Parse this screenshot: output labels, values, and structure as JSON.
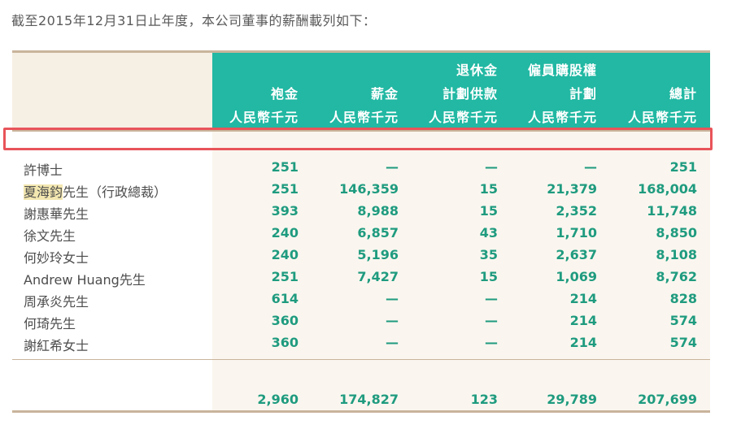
{
  "intro": "截至2015年12月31日止年度，本公司董事的薪酬載列如下：",
  "columns": [
    {
      "l1": "",
      "l2": "袍金",
      "l3": "人民幣千元"
    },
    {
      "l1": "",
      "l2": "薪金",
      "l3": "人民幣千元"
    },
    {
      "l1": "退休金",
      "l2": "計劃供款",
      "l3": "人民幣千元"
    },
    {
      "l1": "僱員購股權",
      "l2": "計劃",
      "l3": "人民幣千元"
    },
    {
      "l1": "",
      "l2": "總計",
      "l3": "人民幣千元"
    }
  ],
  "rows": [
    {
      "name": "許博士",
      "v": [
        "251",
        "—",
        "—",
        "—",
        "251"
      ]
    },
    {
      "name_hl": "夏海鈞",
      "name_rest": "先生（行政總裁）",
      "v": [
        "251",
        "146,359",
        "15",
        "21,379",
        "168,004"
      ]
    },
    {
      "name": "謝惠華先生",
      "v": [
        "393",
        "8,988",
        "15",
        "2,352",
        "11,748"
      ]
    },
    {
      "name": "徐文先生",
      "v": [
        "240",
        "6,857",
        "43",
        "1,710",
        "8,850"
      ]
    },
    {
      "name": "何妙玲女士",
      "v": [
        "240",
        "5,196",
        "35",
        "2,637",
        "8,108"
      ]
    },
    {
      "name": "Andrew Huang先生",
      "v": [
        "251",
        "7,427",
        "15",
        "1,069",
        "8,762"
      ]
    },
    {
      "name": "周承炎先生",
      "v": [
        "614",
        "—",
        "—",
        "214",
        "828"
      ]
    },
    {
      "name": "何琦先生",
      "v": [
        "360",
        "—",
        "—",
        "214",
        "574"
      ]
    },
    {
      "name": "謝紅希女士",
      "v": [
        "360",
        "—",
        "—",
        "214",
        "574"
      ]
    }
  ],
  "total": [
    "2,960",
    "174,827",
    "123",
    "29,789",
    "207,699"
  ],
  "colors": {
    "header_teal": "#22b8a3",
    "value_green": "#1f9b7f",
    "highlight_border": "#e8545a",
    "rule_tan": "#c9b49b"
  }
}
